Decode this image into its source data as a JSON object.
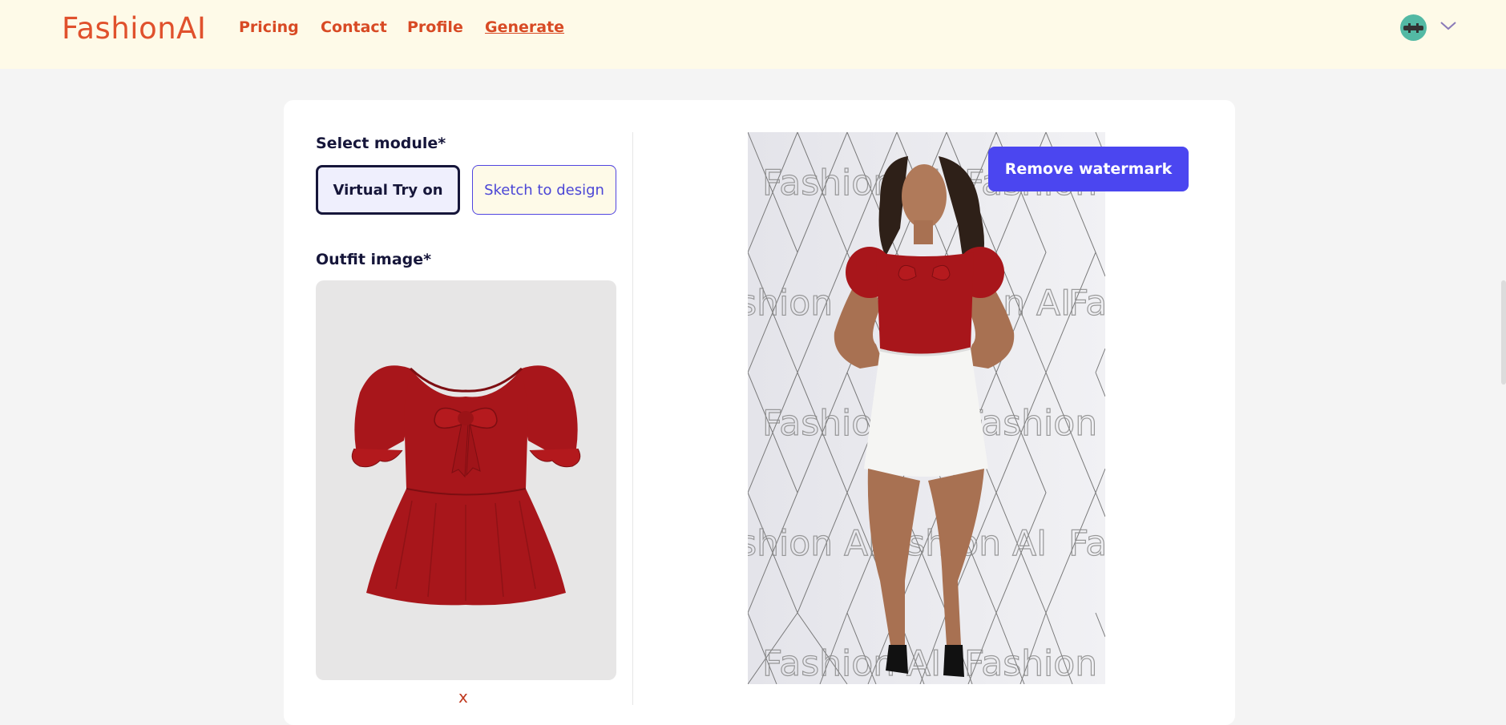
{
  "header": {
    "logo": "FashionAI",
    "nav": [
      {
        "label": "Pricing"
      },
      {
        "label": "Contact"
      },
      {
        "label": "Profile"
      },
      {
        "label": "Generate"
      }
    ],
    "active_nav": "Generate"
  },
  "form": {
    "module_label": "Select module*",
    "modules": [
      {
        "label": "Virtual Try on",
        "selected": true
      },
      {
        "label": "Sketch to design",
        "selected": false
      }
    ],
    "outfit_label": "Outfit image*",
    "remove_label": "x"
  },
  "result": {
    "remove_watermark_label": "Remove watermark",
    "watermark_text": "Fashion AI"
  },
  "colors": {
    "brand": "#e0512d",
    "accent": "#4b46f0",
    "header_bg": "#fefae8",
    "page_bg": "#f4f4f4",
    "garment": "#a8161b"
  },
  "icons": {
    "user_avatar": "avatar-icon",
    "menu_toggle": "chevron-down-icon"
  }
}
